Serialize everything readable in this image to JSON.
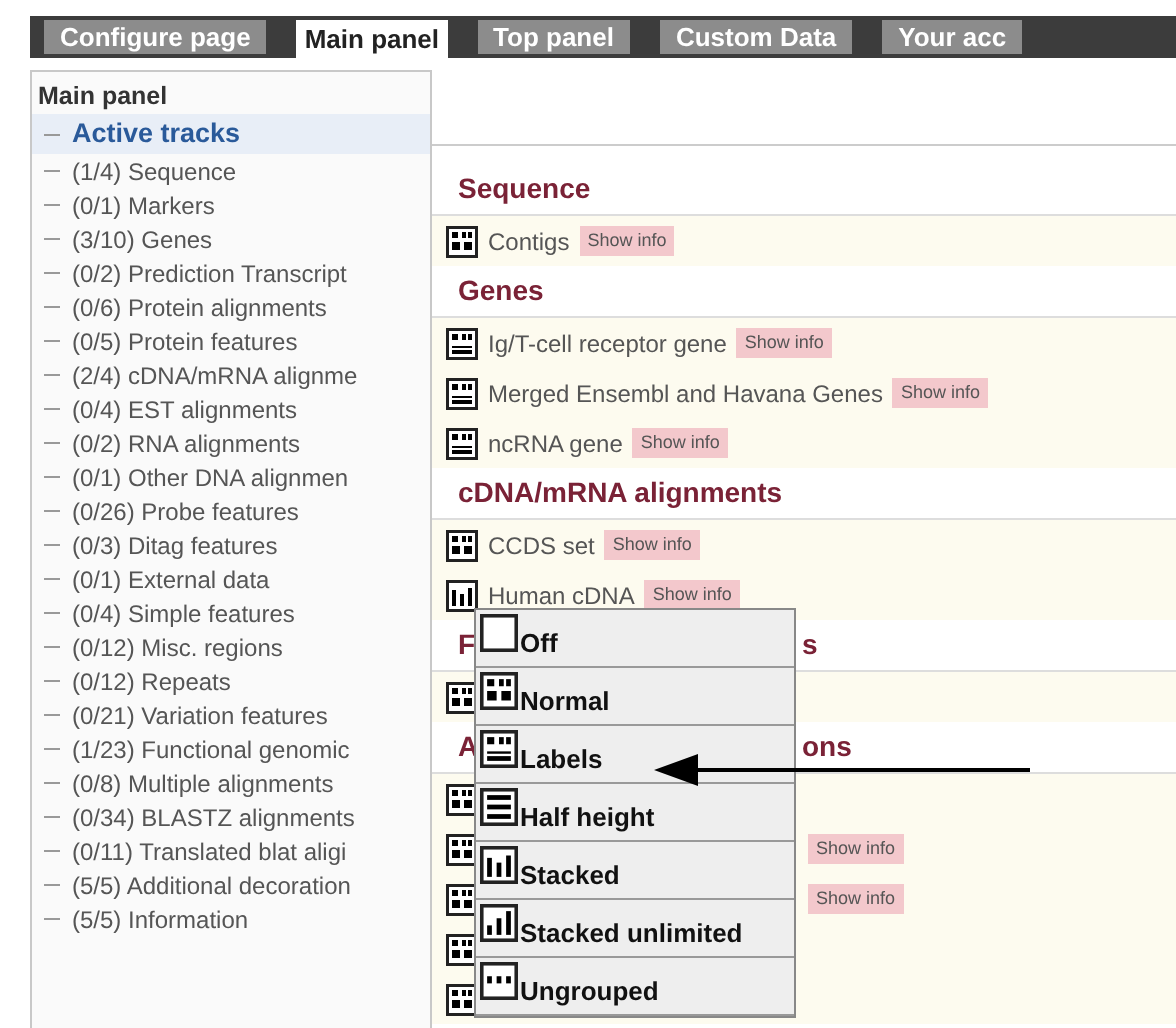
{
  "tabs": [
    {
      "label": "Configure page",
      "selected": false
    },
    {
      "label": "Main panel",
      "selected": true
    },
    {
      "label": "Top panel",
      "selected": false
    },
    {
      "label": "Custom Data",
      "selected": false
    },
    {
      "label": "Your acc",
      "selected": false
    }
  ],
  "sidebar": {
    "title": "Main panel",
    "items": [
      {
        "label": "Active tracks",
        "selected": true
      },
      {
        "label": "(1/4) Sequence",
        "selected": false
      },
      {
        "label": "(0/1) Markers",
        "selected": false
      },
      {
        "label": "(3/10) Genes",
        "selected": false
      },
      {
        "label": "(0/2) Prediction Transcript",
        "selected": false
      },
      {
        "label": "(0/6) Protein alignments",
        "selected": false
      },
      {
        "label": "(0/5) Protein features",
        "selected": false
      },
      {
        "label": "(2/4) cDNA/mRNA alignme",
        "selected": false
      },
      {
        "label": "(0/4) EST alignments",
        "selected": false
      },
      {
        "label": "(0/2) RNA alignments",
        "selected": false
      },
      {
        "label": "(0/1) Other DNA alignmen",
        "selected": false
      },
      {
        "label": "(0/26) Probe features",
        "selected": false
      },
      {
        "label": "(0/3) Ditag features",
        "selected": false
      },
      {
        "label": "(0/1) External data",
        "selected": false
      },
      {
        "label": "(0/4) Simple features",
        "selected": false
      },
      {
        "label": "(0/12) Misc. regions",
        "selected": false
      },
      {
        "label": "(0/12) Repeats",
        "selected": false
      },
      {
        "label": "(0/21) Variation features",
        "selected": false
      },
      {
        "label": "(1/23) Functional genomic",
        "selected": false
      },
      {
        "label": "(0/8) Multiple alignments",
        "selected": false
      },
      {
        "label": "(0/34) BLASTZ alignments",
        "selected": false
      },
      {
        "label": "(0/11) Translated blat aligi",
        "selected": false
      },
      {
        "label": "(5/5) Additional decoration",
        "selected": false
      },
      {
        "label": "(5/5) Information",
        "selected": false
      }
    ]
  },
  "sections": [
    {
      "heading": [
        "Sequence"
      ],
      "tracks": [
        {
          "name": "Contigs",
          "kind": "normal",
          "info_button": "Show info"
        }
      ]
    },
    {
      "heading": [
        "Genes"
      ],
      "tracks": [
        {
          "name": "Ig/T-cell receptor gene",
          "kind": "labels",
          "info_button": "Show info"
        },
        {
          "name": "Merged Ensembl and Havana Genes",
          "kind": "labels",
          "info_button": "Show info"
        },
        {
          "name": "ncRNA gene",
          "kind": "labels",
          "info_button": "Show info"
        }
      ]
    },
    {
      "heading": [
        "cDNA/mRNA alignments"
      ],
      "tracks": [
        {
          "name": "CCDS set",
          "kind": "normal",
          "info_button": "Show info"
        },
        {
          "name": "Human cDNA",
          "kind": "stacked",
          "info_button": "Show info"
        }
      ]
    },
    {
      "heading": [
        "F",
        "s"
      ],
      "tracks": [
        {
          "kind": "normal"
        }
      ]
    },
    {
      "heading": [
        "A",
        "ons"
      ],
      "tracks": [
        {
          "kind": "normal"
        },
        {
          "kind": "normal",
          "info_button": "Show info"
        },
        {
          "kind": "normal",
          "info_button": "Show info"
        },
        {
          "kind": "normal"
        },
        {
          "kind": "normal"
        }
      ]
    }
  ],
  "style_menu": {
    "items": [
      {
        "label": "Off",
        "kind": "off"
      },
      {
        "label": "Normal",
        "kind": "normal"
      },
      {
        "label": "Labels",
        "kind": "labels"
      },
      {
        "label": "Half height",
        "kind": "half"
      },
      {
        "label": "Stacked",
        "kind": "stacked"
      },
      {
        "label": "Stacked unlimited",
        "kind": "stacked_unlimited"
      },
      {
        "label": "Ungrouped",
        "kind": "ungrouped"
      }
    ]
  }
}
